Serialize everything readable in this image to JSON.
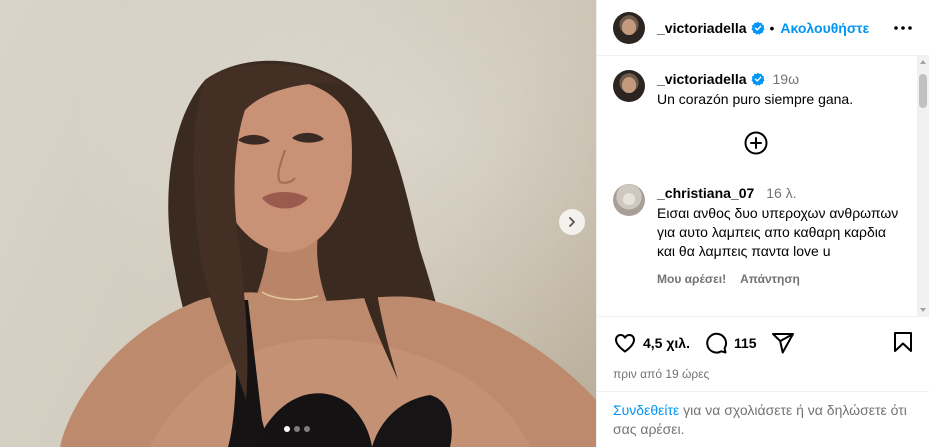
{
  "post": {
    "username": "_victoriadella",
    "separator": "•",
    "follow_label": "Ακολουθήστε",
    "caption": {
      "username": "_victoriadella",
      "time": "19ω",
      "text": "Un corazón puro siempre gana."
    },
    "comments": [
      {
        "username": "_christiana_07",
        "time": "16 λ.",
        "text": "Εισαι ανθος δυο υπεροχων ανθρωπων για αυτο λαμπεις απο καθαρη καρδια και θα λαμπεις παντα love u",
        "like_label": "Μου αρέσει!",
        "reply_label": "Απάντηση"
      }
    ],
    "likes_count": "4,5 χιλ.",
    "comments_count": "115",
    "date_text": "πριν από 19 ώρες",
    "carousel": {
      "slides": 3,
      "active_index": 0
    }
  },
  "login_prompt": {
    "link_label": "Συνδεθείτε",
    "text": " για να σχολιάσετε ή να δηλώσετε ότι σας αρέσει."
  },
  "colors": {
    "accent": "#0095f6",
    "secondary_text": "#737373",
    "divider": "#efefef",
    "verified": "#0095f6"
  },
  "icons": {
    "verified": "verified-badge-icon",
    "more": "more-options-icon",
    "load_more": "plus-circle-icon",
    "like": "heart-icon",
    "comment": "comment-bubble-icon",
    "share": "paper-plane-icon",
    "save": "bookmark-icon",
    "next": "chevron-right-icon"
  }
}
